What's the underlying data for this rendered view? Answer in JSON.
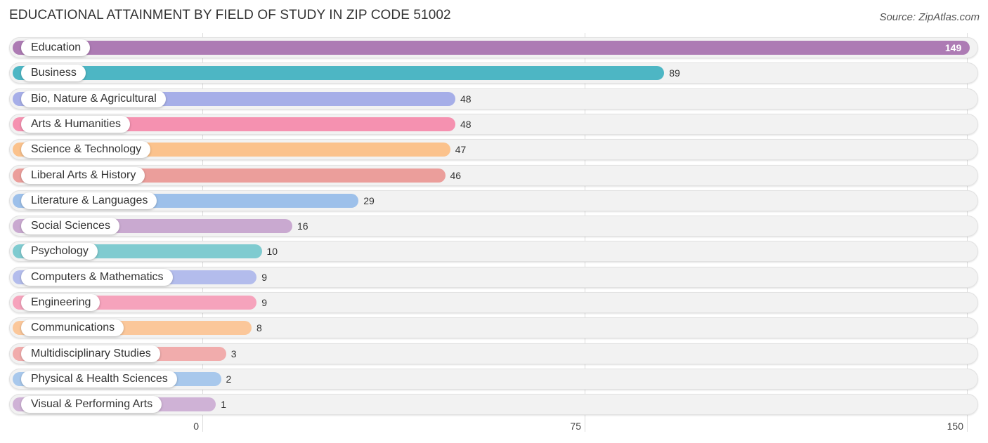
{
  "chart_data": {
    "type": "bar",
    "orientation": "horizontal",
    "title": "EDUCATIONAL ATTAINMENT BY FIELD OF STUDY IN ZIP CODE 51002",
    "source": "Source: ZipAtlas.com",
    "xlabel": "",
    "ylabel": "",
    "xlim": [
      0,
      150
    ],
    "xticks": [
      0,
      75,
      150
    ],
    "xtick_labels": [
      "0",
      "75",
      "150"
    ],
    "grid": true,
    "categories": [
      "Education",
      "Business",
      "Bio, Nature & Agricultural",
      "Arts & Humanities",
      "Science & Technology",
      "Liberal Arts & History",
      "Literature & Languages",
      "Social Sciences",
      "Psychology",
      "Computers & Mathematics",
      "Engineering",
      "Communications",
      "Multidisciplinary Studies",
      "Physical & Health Sciences",
      "Visual & Performing Arts"
    ],
    "values": [
      149,
      89,
      48,
      48,
      47,
      46,
      29,
      16,
      10,
      9,
      9,
      8,
      3,
      2,
      1
    ],
    "colors": [
      "#ad7bb4",
      "#4db6c4",
      "#a6aee8",
      "#f591b0",
      "#fbc28c",
      "#eb9e9b",
      "#9dc0ea",
      "#c9a9d0",
      "#7fcbd0",
      "#b3bcec",
      "#f6a3bc",
      "#fbc79a",
      "#f1acac",
      "#a8c8ec",
      "#cfb2d6"
    ]
  }
}
